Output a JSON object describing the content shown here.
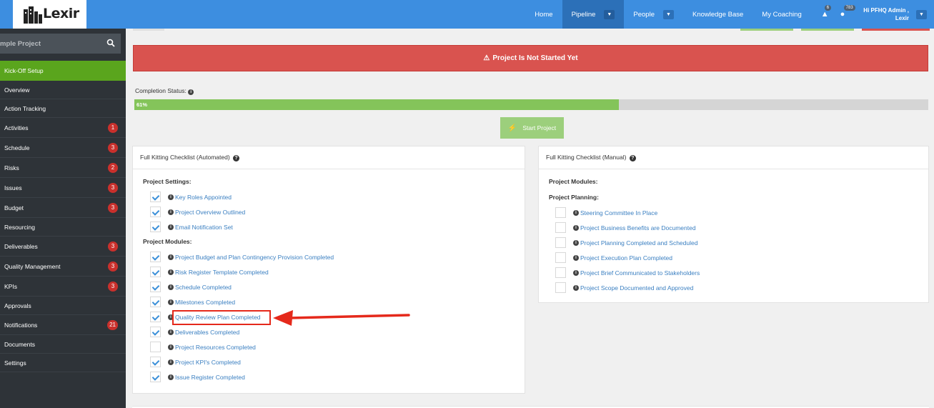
{
  "header": {
    "logo_text": "Lexir",
    "nav": [
      {
        "label": "Home",
        "has_caret": false,
        "active": false
      },
      {
        "label": "Pipeline",
        "has_caret": true,
        "active": true
      },
      {
        "label": "People",
        "has_caret": true,
        "active": false
      },
      {
        "label": "Knowledge Base",
        "has_caret": false,
        "active": false
      },
      {
        "label": "My Coaching",
        "has_caret": false,
        "active": false
      }
    ],
    "alerts_count": "6",
    "notifications_count": "783",
    "user_greeting": "Hi PFHQ Admin ,",
    "user_name": "Lexir"
  },
  "sidebar": {
    "search_text": "mple Project",
    "items": [
      {
        "label": "Kick-Off Setup",
        "badge": "",
        "active": true
      },
      {
        "label": "Overview",
        "badge": ""
      },
      {
        "label": "Action Tracking",
        "badge": ""
      },
      {
        "label": "Activities",
        "badge": "1"
      },
      {
        "label": "Schedule",
        "badge": "3"
      },
      {
        "label": "Risks",
        "badge": "2"
      },
      {
        "label": "Issues",
        "badge": "3"
      },
      {
        "label": "Budget",
        "badge": "3"
      },
      {
        "label": "Resourcing",
        "badge": ""
      },
      {
        "label": "Deliverables",
        "badge": "3"
      },
      {
        "label": "Quality Management",
        "badge": "3"
      },
      {
        "label": "KPIs",
        "badge": "3"
      },
      {
        "label": "Approvals",
        "badge": ""
      },
      {
        "label": "Notifications",
        "badge": "21"
      },
      {
        "label": "Documents",
        "badge": ""
      },
      {
        "label": "Settings",
        "badge": ""
      }
    ]
  },
  "main": {
    "alert_text": "Project Is Not Started Yet",
    "completion_label": "Completion Status:",
    "completion_percent": 61,
    "completion_text": "61%",
    "start_button": "Start Project",
    "automated_panel": {
      "title": "Full Kitting Checklist (Automated)",
      "settings_title": "Project Settings:",
      "settings": [
        {
          "label": "Key Roles Appointed",
          "checked": true
        },
        {
          "label": "Project Overview Outlined",
          "checked": true
        },
        {
          "label": "Email Notification Set",
          "checked": true
        }
      ],
      "modules_title": "Project Modules:",
      "modules": [
        {
          "label": "Project Budget and Plan Contingency Provision Completed",
          "checked": true
        },
        {
          "label": "Risk Register Template Completed",
          "checked": true
        },
        {
          "label": "Schedule Completed",
          "checked": true
        },
        {
          "label": "Milestones Completed",
          "checked": true
        },
        {
          "label": "Quality Review Plan Completed",
          "checked": true
        },
        {
          "label": "Deliverables Completed",
          "checked": true
        },
        {
          "label": "Project Resources Completed",
          "checked": false
        },
        {
          "label": "Project KPI's Completed",
          "checked": true
        },
        {
          "label": "Issue Register Completed",
          "checked": true
        }
      ]
    },
    "manual_panel": {
      "title": "Full Kitting Checklist (Manual)",
      "modules_title": "Project Modules:",
      "planning_title": "Project Planning:",
      "planning": [
        {
          "label": "Steering Committee In Place",
          "checked": false
        },
        {
          "label": "Project Business Benefits are Documented",
          "checked": false
        },
        {
          "label": "Project Planning Completed and Scheduled",
          "checked": false
        },
        {
          "label": "Project Execution Plan Completed",
          "checked": false
        },
        {
          "label": "Project Brief Communicated to Stakeholders",
          "checked": false
        },
        {
          "label": "Project Scope Documented and Approved",
          "checked": false
        }
      ]
    }
  },
  "colors": {
    "header_blue": "#3d8ee0",
    "sidebar_bg": "#2e3338",
    "active_green": "#5aa51d",
    "alert_red": "#d9534f",
    "progress_green": "#84c45a",
    "link_blue": "#3a7fc1",
    "annotation_red": "#e5291b"
  }
}
